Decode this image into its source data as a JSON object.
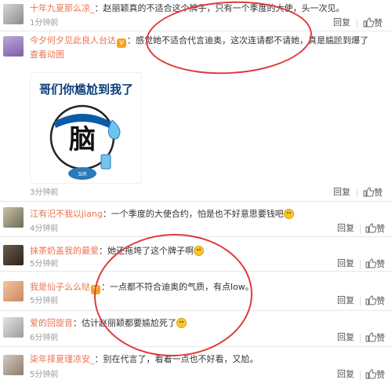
{
  "comments": [
    {
      "user": "十年九夏那么凉_",
      "vip": false,
      "text": "赵丽颖真的不适合这个牌子，只有一个季度的大使，头一次见。",
      "time": "1分钟前",
      "reply": "回复",
      "likes": "赞"
    },
    {
      "user": "今夕何夕见此良人台达",
      "vip": true,
      "text": "感觉她不适合代言迪奥，这次连请都不请她，真是尴尬到爆了",
      "link": "查看动图",
      "time": "3分钟前",
      "reply": "回复",
      "likes": "赞",
      "sticker_text": "哥们你尴尬到我了",
      "sticker_big": "脑",
      "sticker_tag": "SIR"
    },
    {
      "user": "江有汜不我以jiang",
      "vip": true,
      "text": "一个季度的大使合约，怕是也不好意思要钱吧",
      "time": "4分钟前",
      "reply": "回复",
      "likes": "赞"
    },
    {
      "user": "抹茶奶盖我的最爱",
      "vip": false,
      "text": "她还拖垮了这个牌子啊",
      "time": "5分钟前",
      "reply": "回复",
      "likes": "赞"
    },
    {
      "user": "我是仙子么么哒",
      "vip": true,
      "text": "一点都不符合迪奥的气质，有点low。",
      "time": "5分钟前",
      "reply": "回复",
      "likes": "赞"
    },
    {
      "user": "爱的回旋音",
      "vip": false,
      "text": "估计赵丽颖都要尴尬死了",
      "time": "6分钟前",
      "reply": "回复",
      "likes": "赞"
    },
    {
      "user": "柒年择夏瑾凉安_",
      "vip": false,
      "text": "别在代言了，看着一点也不好看，又尬。",
      "time": "5分钟前",
      "reply": "回复",
      "likes": "赞"
    }
  ],
  "colors": {
    "username": "#eb7350",
    "vip_badge": "#f7a31a",
    "annotation_circle": "#e03a3a",
    "time": "#999999"
  }
}
